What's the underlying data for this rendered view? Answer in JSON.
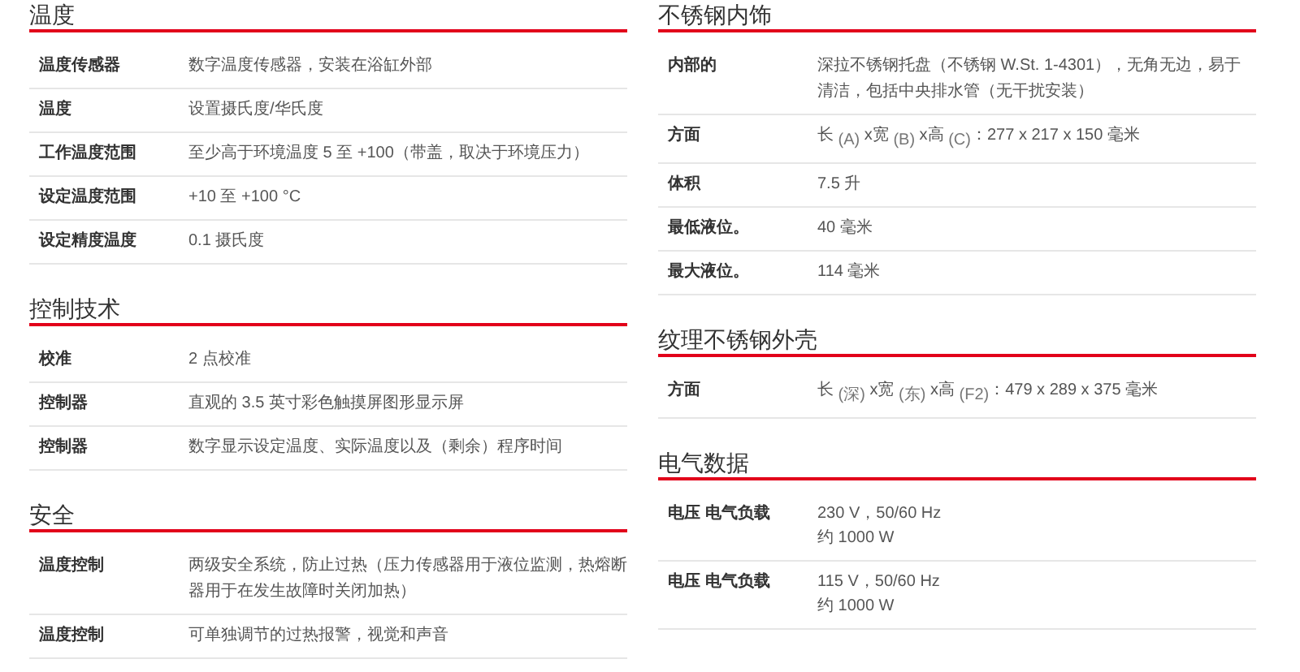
{
  "columns": [
    {
      "sections": [
        {
          "title": "温度",
          "rows": [
            {
              "label": "温度传感器",
              "value": "数字温度传感器，安装在浴缸外部"
            },
            {
              "label": "温度",
              "value": "设置摄氏度/华氏度"
            },
            {
              "label": "工作温度范围",
              "value": "至少高于环境温度 5 至 +100（带盖，取决于环境压力）"
            },
            {
              "label": "设定温度范围",
              "value": "+10 至 +100 °C"
            },
            {
              "label": "设定精度温度",
              "value": "0.1 摄氏度"
            }
          ]
        },
        {
          "title": "控制技术",
          "rows": [
            {
              "label": "校准",
              "value": "2 点校准"
            },
            {
              "label": "控制器",
              "value": "直观的 3.5 英寸彩色触摸屏图形显示屏"
            },
            {
              "label": "控制器",
              "value": "数字显示设定温度、实际温度以及（剩余）程序时间"
            }
          ]
        },
        {
          "title": "安全",
          "rows": [
            {
              "label": "温度控制",
              "value": "两级安全系统，防止过热（压力传感器用于液位监测，热熔断器用于在发生故障时关闭加热）"
            },
            {
              "label": "温度控制",
              "value": "可单独调节的过热报警，视觉和声音"
            }
          ]
        }
      ]
    },
    {
      "sections": [
        {
          "title": "不锈钢内饰",
          "rows": [
            {
              "label": "内部的",
              "value": "深拉不锈钢托盘（不锈钢 W.St. 1-4301），无角无边，易于清洁，包括中央排水管（无干扰安装）"
            },
            {
              "label": "方面",
              "value": "长 $_{(A)}$ x宽 $_{(B)}$ x高 $_{(C)}$：277 x 217 x 150 毫米"
            },
            {
              "label": "体积",
              "value": "7.5 升"
            },
            {
              "label": "最低液位。",
              "value": "40 毫米"
            },
            {
              "label": "最大液位。",
              "value": "114 毫米"
            }
          ]
        },
        {
          "title": "纹理不锈钢外壳",
          "rows": [
            {
              "label": "方面",
              "value": "长 $_{(深)}$ x宽 $_{(东)}$ x高 $_{(F2)}$：479 x 289 x 375 毫米"
            }
          ]
        },
        {
          "title": "电气数据",
          "rows": [
            {
              "label": "电压 电气负载",
              "lines": [
                "230 V，50/60 Hz",
                "约 1000 W"
              ]
            },
            {
              "label": "电压 电气负载",
              "lines": [
                "115 V，50/60 Hz",
                "约 1000 W"
              ]
            }
          ]
        }
      ]
    }
  ]
}
